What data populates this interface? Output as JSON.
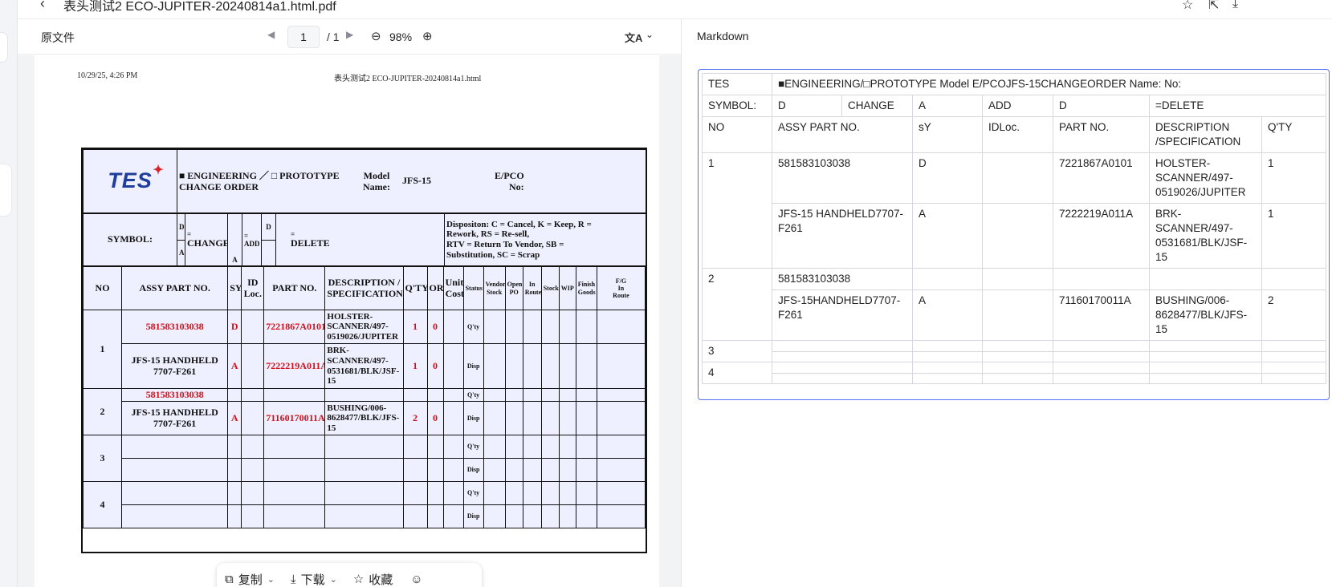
{
  "titlebar": {
    "title": "表头测试2 ECO-JUPITER-20240814a1.html.pdf"
  },
  "viewer": {
    "source_label": "原文件",
    "page_current": "1",
    "page_total": "/ 1",
    "zoom": "98%"
  },
  "document": {
    "print_date": "10/29/25, 4:26 PM",
    "print_title": "表头测试2 ECO-JUPITER-20240814a1.html",
    "logo": "TES",
    "header": {
      "eng_line1": "■ ENGINEERING ／ □ PROTOTYPE",
      "eng_line2": "CHANGE ORDER",
      "model_label_1": "Model",
      "model_label_2": "Name:",
      "model_value": "JFS-15",
      "epco_label_1": "E/PCO",
      "epco_label_2": "No:"
    },
    "symbol": {
      "label": "SYMBOL:",
      "d": "D",
      "eq1": "=",
      "change": "CHANGE",
      "a": "A",
      "eq2": "=",
      "add": "ADD",
      "d2": "D",
      "eq3": "=",
      "delete": "DELETE",
      "disposition_1": "Dispositon: C = Cancel, K = Keep, R =",
      "disposition_2": "Rework, RS = Re-sell,",
      "disposition_3": "RTV = Return To Vendor, SB =",
      "disposition_4": "Substitution, SC = Scrap"
    },
    "columns": {
      "no": "NO",
      "assy": "ASSY PART NO.",
      "sy": "SY",
      "id_1": "ID",
      "id_2": "Loc.",
      "part": "PART NO.",
      "desc_1": "DESCRIPTION /",
      "desc_2": "SPECIFICATION",
      "qty": "Q'TY",
      "or": "OR",
      "unit_1": "Unit",
      "unit_2": "Cost",
      "status": "Status",
      "vendor_1": "Vendor",
      "vendor_2": "Stock",
      "open_1": "Open",
      "open_2": "PO",
      "inroute_1": "In",
      "inroute_2": "Route",
      "stock": "Stock",
      "wip": "WIP",
      "finish_1": "Finish",
      "finish_2": "Goods",
      "fg_1": "F/G",
      "fg_2": "In",
      "fg_3": "Route"
    },
    "status_labels": {
      "qty": "Q'ty",
      "disp": "Disp"
    },
    "rows": [
      {
        "no": "1",
        "items": [
          {
            "assy": "581583103038",
            "sy": "D",
            "part": "7221867A0101",
            "desc": "HOLSTER-SCANNER/497-0519026/JUPITER",
            "qty": "1",
            "or": "0"
          },
          {
            "assy": "JFS-15 HANDHELD 7707-F261",
            "sy": "A",
            "part": "7222219A011A",
            "desc": "BRK-SCANNER/497-0531681/BLK/JSF-15",
            "qty": "1",
            "or": "0"
          }
        ]
      },
      {
        "no": "2",
        "items": [
          {
            "assy": "581583103038"
          },
          {
            "assy": "JFS-15 HANDHELD 7707-F261",
            "sy": "A",
            "part": "71160170011A",
            "desc": "BUSHING/006-8628477/BLK/JFS-15",
            "qty": "2",
            "or": "0"
          }
        ]
      },
      {
        "no": "3"
      },
      {
        "no": "4"
      }
    ]
  },
  "toolbar": {
    "copy": "复制",
    "download": "下载",
    "favorite": "收藏"
  },
  "markdown": {
    "label": "Markdown",
    "r1": {
      "c1": "TES",
      "c2": "■ENGINEERING/□PROTOTYPE Model E/PCOJFS-15CHANGEORDER Name: No:"
    },
    "r2": {
      "c1": "SYMBOL:",
      "c2": "D",
      "c3": "CHANGE",
      "c4": "A",
      "c5": "ADD",
      "c6": "D",
      "c7": "=DELETE"
    },
    "r3": {
      "c1": "NO",
      "c2": "ASSY PART NO.",
      "c3": "sY",
      "c4": "IDLoc.",
      "c5": "PART NO.",
      "c6": "DESCRIPTION /SPECIFICATION",
      "c7": "Q'TY"
    },
    "r4": {
      "no": "1",
      "assy": "581583103038",
      "sy": "D",
      "part": "7221867A0101",
      "desc": "HOLSTER-SCANNER/497-0519026/JUPITER",
      "qty": "1"
    },
    "r5": {
      "assy": "JFS-15 HANDHELD7707-F261",
      "sy": "A",
      "part": "7222219A011A",
      "desc": "BRK-SCANNER/497-0531681/BLK/JSF-15",
      "qty": "1"
    },
    "r6": {
      "no": "2",
      "assy": "581583103038"
    },
    "r7": {
      "assy": "JFS-15HANDHELD7707-F261",
      "sy": "A",
      "part": "71160170011A",
      "desc": "BUSHING/006-8628477/BLK/JFS-15",
      "qty": "2"
    },
    "r8": {
      "no": "3"
    },
    "r9": {
      "no": "4"
    }
  }
}
